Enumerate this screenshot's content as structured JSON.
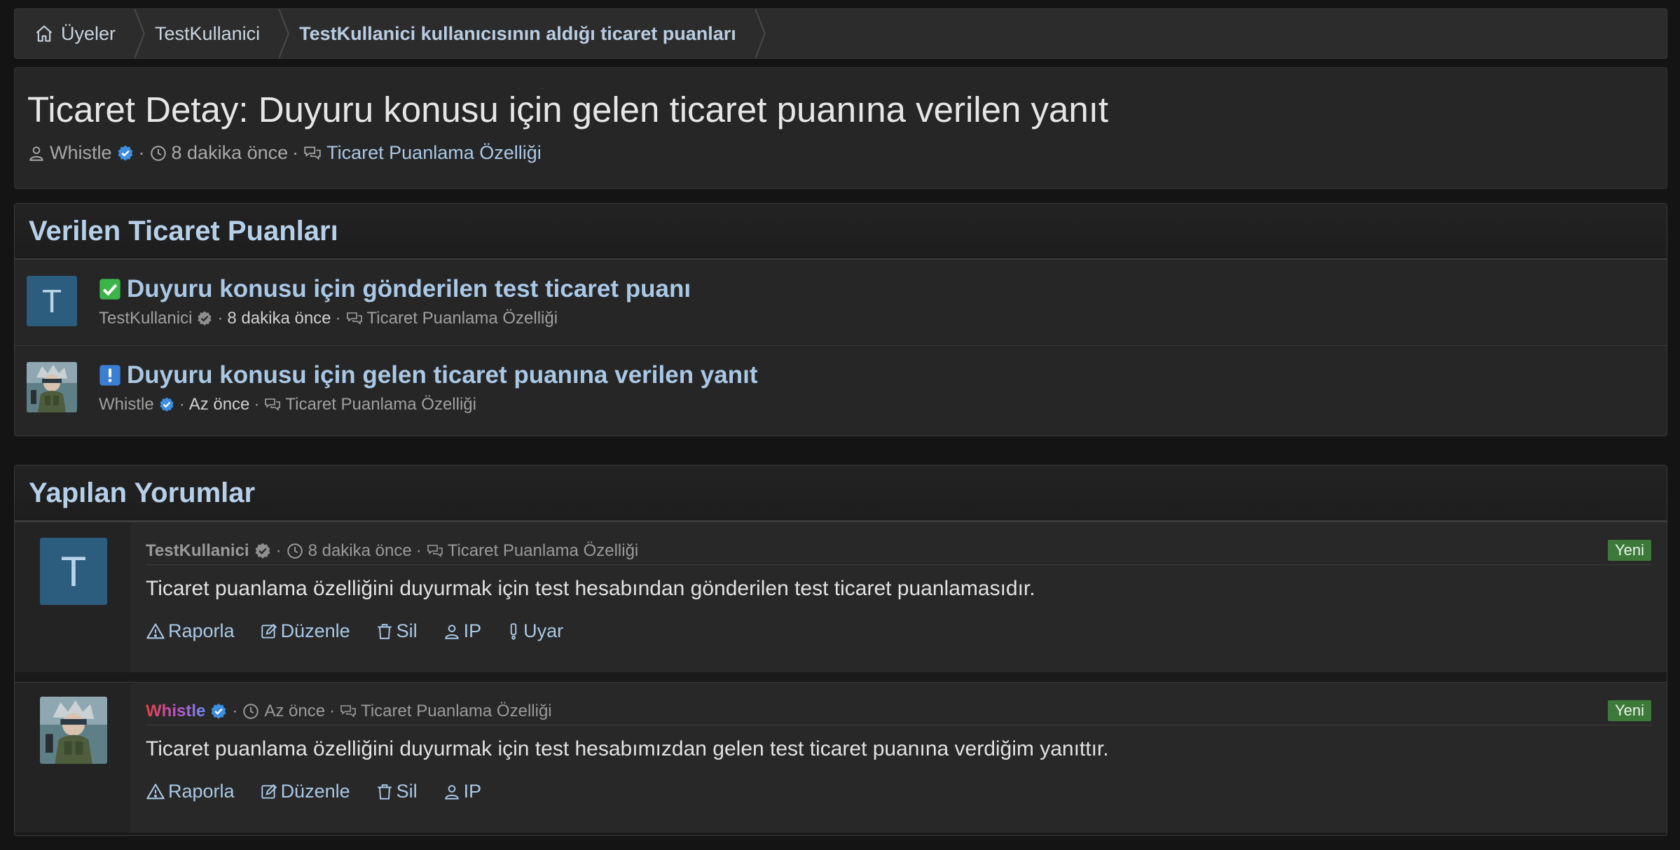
{
  "breadcrumb": {
    "items": [
      {
        "label": "Üyeler",
        "icon": "home-icon"
      },
      {
        "label": "TestKullanici"
      },
      {
        "label": "TestKullanici kullanıcısının aldığı ticaret puanları"
      }
    ]
  },
  "header": {
    "title": "Ticaret Detay: Duyuru konusu için gelen ticaret puanına verilen yanıt",
    "author": "Whistle",
    "time": "8 dakika önce",
    "forum": "Ticaret Puanlama Özelliği",
    "separator": "·"
  },
  "ratings": {
    "title": "Verilen Ticaret Puanları",
    "items": [
      {
        "avatar_letter": "T",
        "status_icon": "check-icon",
        "status_color": "#3bb54a",
        "title": "Duyuru konusu için gönderilen test ticaret puanı",
        "user": "TestKullanici",
        "time": "8 dakika önce",
        "forum": "Ticaret Puanlama Özelliği"
      },
      {
        "avatar_letter": "",
        "status_icon": "exclamation-icon",
        "status_color": "#3b7fd4",
        "title": "Duyuru konusu için gelen ticaret puanına verilen yanıt",
        "user": "Whistle",
        "time": "Az önce",
        "forum": "Ticaret Puanlama Özelliği"
      }
    ]
  },
  "comments": {
    "title": "Yapılan Yorumlar",
    "new_badge": "Yeni",
    "actions": {
      "report": "Raporla",
      "edit": "Düzenle",
      "delete": "Sil",
      "ip": "IP",
      "warn": "Uyar"
    },
    "items": [
      {
        "avatar_letter": "T",
        "user": "TestKullanici",
        "time": "8 dakika önce",
        "forum": "Ticaret Puanlama Özelliği",
        "body": "Ticaret puanlama özelliğini duyurmak için test hesabından gönderilen test ticaret puanlamasıdır."
      },
      {
        "avatar_letter": "",
        "user": "Whistle",
        "time": "Az önce",
        "forum": "Ticaret Puanlama Özelliği",
        "body": "Ticaret puanlama özelliğini duyurmak için test hesabımızdan gelen test ticaret puanına verdiğim yanıttır."
      }
    ]
  },
  "colors": {
    "link": "#a9c8e6",
    "title_blue": "#b6d0ea",
    "new_badge": "#3d7a3a",
    "verified": "#3d8fe0",
    "verified_grey": "#8f8f8f",
    "avatar_bg": "#2c5d7e"
  }
}
